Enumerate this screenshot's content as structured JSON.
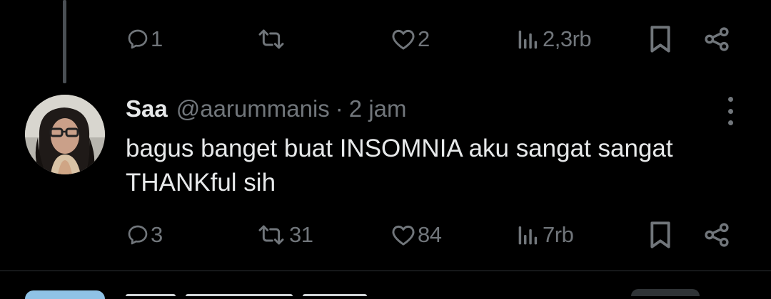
{
  "previous_tweet": {
    "actions": {
      "replies": "1",
      "retweets": "",
      "likes": "2",
      "views": "2,3rb"
    }
  },
  "tweet": {
    "name": "Saa",
    "handle": "@aarummanis",
    "separator": "·",
    "time": "2 jam",
    "text_line1": "bagus banget buat INSOMNIA aku sangat sangat",
    "text_line2": "THANKful sih",
    "actions": {
      "replies": "3",
      "retweets": "31",
      "likes": "84",
      "views": "7rb"
    }
  },
  "icons": {
    "reply": "reply-icon",
    "retweet": "retweet-icon",
    "like": "heart-icon",
    "views": "views-icon",
    "bookmark": "bookmark-icon",
    "share": "share-icon",
    "more": "more-icon"
  },
  "colors": {
    "background": "#000000",
    "text": "#e7e9ea",
    "muted": "#71767b",
    "divider": "#2f3336"
  }
}
